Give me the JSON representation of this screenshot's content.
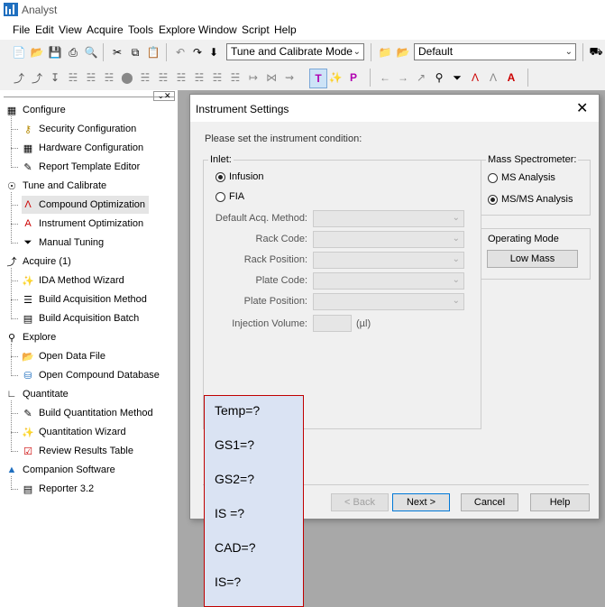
{
  "app": {
    "title": "Analyst"
  },
  "menu": [
    "File",
    "Edit",
    "View",
    "Acquire",
    "Tools",
    "Explore",
    "Window",
    "Script",
    "Help"
  ],
  "toolbar": {
    "mode_combo": "Tune and Calibrate Mode",
    "project_combo": "Default"
  },
  "sidebar": {
    "sections": [
      {
        "label": "Configure",
        "icon": "configure-icon",
        "items": [
          {
            "label": "Security Configuration",
            "icon": "key-icon"
          },
          {
            "label": "Hardware Configuration",
            "icon": "hardware-icon"
          },
          {
            "label": "Report Template Editor",
            "icon": "report-template-icon"
          }
        ]
      },
      {
        "label": "Tune and Calibrate",
        "icon": "tune-icon",
        "items": [
          {
            "label": "Compound Optimization",
            "icon": "compound-optimization-icon",
            "selected": true
          },
          {
            "label": "Instrument Optimization",
            "icon": "instrument-optimization-icon"
          },
          {
            "label": "Manual Tuning",
            "icon": "manual-tuning-icon"
          }
        ]
      },
      {
        "label": "Acquire  (1)",
        "icon": "acquire-icon",
        "items": [
          {
            "label": "IDA Method Wizard",
            "icon": "wand-icon"
          },
          {
            "label": "Build Acquisition Method",
            "icon": "method-icon"
          },
          {
            "label": "Build Acquisition Batch",
            "icon": "batch-icon"
          }
        ]
      },
      {
        "label": "Explore",
        "icon": "explore-icon",
        "items": [
          {
            "label": "Open Data File",
            "icon": "folder-icon"
          },
          {
            "label": "Open Compound Database",
            "icon": "database-icon"
          }
        ]
      },
      {
        "label": "Quantitate",
        "icon": "quantitate-icon",
        "items": [
          {
            "label": "Build Quantitation Method",
            "icon": "quant-method-icon"
          },
          {
            "label": "Quantitation Wizard",
            "icon": "wand-icon"
          },
          {
            "label": "Review Results Table",
            "icon": "results-table-icon"
          }
        ]
      },
      {
        "label": "Companion Software",
        "icon": "companion-icon",
        "items": [
          {
            "label": "Reporter 3.2",
            "icon": "reporter-icon"
          }
        ]
      }
    ]
  },
  "dialog": {
    "title": "Instrument Settings",
    "prompt": "Please set the instrument condition:",
    "inlet": {
      "label": "Inlet:",
      "options": [
        "Infusion",
        "FIA"
      ],
      "selected": "Infusion",
      "fields": [
        {
          "label": "Default Acq. Method:"
        },
        {
          "label": "Rack Code:"
        },
        {
          "label": "Rack Position:"
        },
        {
          "label": "Plate Code:"
        },
        {
          "label": "Plate Position:"
        }
      ],
      "injection_label": "Injection Volume:",
      "injection_unit": "(µl)"
    },
    "mass_spec": {
      "label": "Mass Spectrometer:",
      "options": [
        "MS Analysis",
        "MS/MS Analysis"
      ],
      "selected": "MS/MS Analysis"
    },
    "operating_mode": {
      "label": "Operating Mode",
      "button": "Low Mass"
    },
    "buttons": {
      "back": "< Back",
      "next": "Next >",
      "cancel": "Cancel",
      "help": "Help"
    }
  },
  "note": {
    "lines": [
      "Temp=?",
      "GS1=?",
      "GS2=?",
      "IS =?",
      "CAD=?",
      "IS=?"
    ]
  }
}
